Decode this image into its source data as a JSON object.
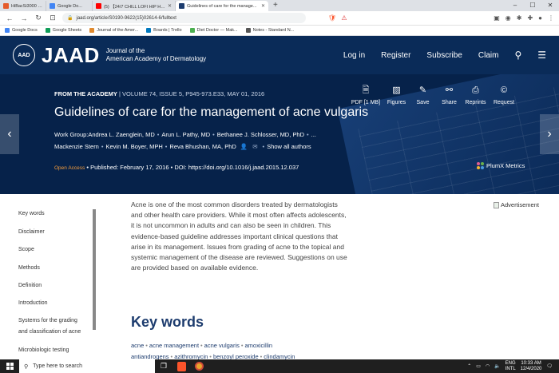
{
  "browser": {
    "tabs": [
      {
        "title": "HiBacSi3000 - Retinol",
        "fav_color": "#e55b2b",
        "active": false
      },
      {
        "title": "Google Do...",
        "fav_color": "#4285f4",
        "active": false
      },
      {
        "title": "(5) 【24/7 CHILL LOFI HIP HOP",
        "fav_color": "#ff0000",
        "active": false
      },
      {
        "title": "Guidelines of care for the manage...",
        "fav_color": "#1d3c6e",
        "active": true
      }
    ],
    "new_tab": "+",
    "url": "jaad.org/article/S0190-9622(15)02614-6/fulltext",
    "bookmarks": [
      {
        "label": "Google Docs",
        "color": "#4285f4"
      },
      {
        "label": "Google Sheets",
        "color": "#0f9d58"
      },
      {
        "label": "Journal of the Amer...",
        "color": "#e08a2e"
      },
      {
        "label": "Boards | Trello",
        "color": "#0079bf"
      },
      {
        "label": "Diet Doctor — Mak...",
        "color": "#4caf50"
      },
      {
        "label": "Notes - Standard N...",
        "color": "#555555"
      }
    ]
  },
  "header": {
    "logo": "AAD",
    "brand": "JAAD",
    "sub_line1": "Journal of the",
    "sub_line2": "American Academy of Dermatology",
    "nav": [
      "Log in",
      "Register",
      "Subscribe",
      "Claim"
    ]
  },
  "hero": {
    "from": "FROM THE ACADEMY",
    "meta": "VOLUME 74, ISSUE 5, P945-973.E33, MAY 01, 2016",
    "title": "Guidelines of care for the management of acne vulgaris",
    "authors_line1": [
      "Work Group:Andrea L. Zaenglein, MD",
      "Arun L. Pathy, MD",
      "Bethanee J. Schlosser, MD, PhD",
      "..."
    ],
    "authors_line2": [
      "Mackenzie Stern",
      "Kevin M. Boyer, MPH",
      "Reva Bhushan, MA, PhD"
    ],
    "show_all": "Show all authors",
    "open_access": "Open Access",
    "published": "Published: February 17, 2016",
    "doi": "DOI: https://doi.org/10.1016/j.jaad.2015.12.037",
    "tools": [
      {
        "icon": "pdf-icon",
        "label": "PDF [1 MB]"
      },
      {
        "icon": "figures-icon",
        "label": "Figures"
      },
      {
        "icon": "save-icon",
        "label": "Save"
      },
      {
        "icon": "share-icon",
        "label": "Share"
      },
      {
        "icon": "reprints-icon",
        "label": "Reprints"
      },
      {
        "icon": "request-icon",
        "label": "Request"
      }
    ],
    "plumx": "PlumX Metrics"
  },
  "toc": [
    "Key words",
    "Disclaimer",
    "Scope",
    "Methods",
    "Definition",
    "Introduction",
    "Systems for the grading",
    "and classification of acne",
    "Microbiologic testing"
  ],
  "abstract": "Acne is one of the most common disorders treated by dermatologists and other health care providers. While it most often affects adolescents, it is not uncommon in adults and can also be seen in children. This evidence-based guideline addresses important clinical questions that arise in its management. Issues from grading of acne to the topical and systemic management of the disease are reviewed. Suggestions on use are provided based on available evidence.",
  "keywords_title": "Key words",
  "keywords_line1": [
    "acne",
    "acne management",
    "acne vulgaris",
    "amoxicillin"
  ],
  "keywords_line2": [
    "antiandrogens",
    "azithromycin",
    "benzoyl peroxide",
    "clindamycin"
  ],
  "advert": "Advertisement",
  "taskbar": {
    "search": "Type here to search",
    "lang1": "ENG",
    "lang2": "INTL",
    "time": "10:33 AM",
    "date": "12/4/2020"
  }
}
